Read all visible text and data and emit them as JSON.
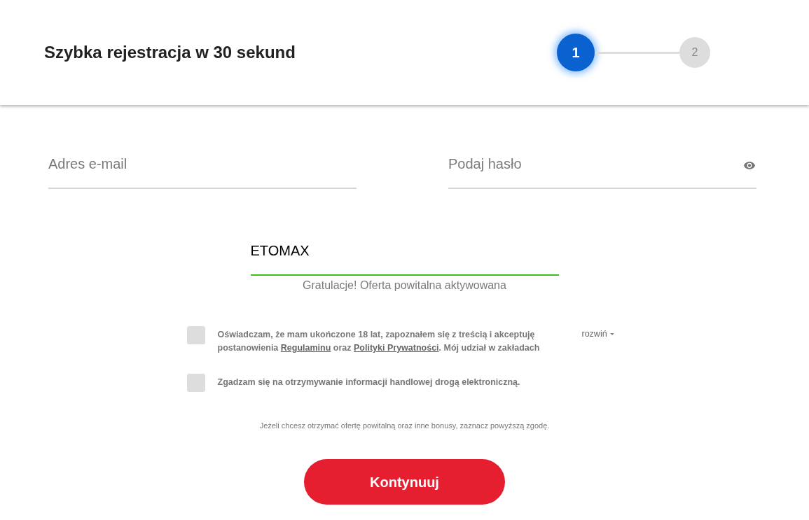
{
  "header": {
    "title": "Szybka rejestracja w 30 sekund",
    "steps": [
      {
        "label": "1",
        "selected": true
      },
      {
        "label": "2",
        "selected": false
      }
    ]
  },
  "fields": [
    {
      "kind": "email",
      "placeholder": "Adres e-mail"
    },
    {
      "kind": "password",
      "placeholder": "Podaj hasło"
    }
  ],
  "promo": {
    "value": "ETOMAX",
    "valid": true,
    "message": "Gratulacje! Oferta powitalna aktywowana"
  },
  "consents": [
    {
      "checked": false,
      "parts": [
        {
          "kind": "text",
          "text": "Oświadczam, że mam ukończone 18 lat, zapoznałem się z treścią i akceptuję postanowienia "
        },
        {
          "kind": "link",
          "text": "Regulaminu"
        },
        {
          "kind": "text",
          "text": " oraz "
        },
        {
          "kind": "link",
          "text": "Polityki Prywatności"
        },
        {
          "kind": "text",
          "text": ". Mój udział w zakładach"
        }
      ],
      "expand": "rozwiń"
    },
    {
      "checked": false,
      "parts": [
        {
          "kind": "text",
          "text": "Zgadzam się na otrzymywanie informacji handlowej drogą elektroniczną."
        }
      ]
    }
  ],
  "note": "Jeżeli chcesz otrzymać ofertę powitalną oraz inne bonusy, zaznacz powyższą zgodę.",
  "submit": "Kontynuuj"
}
